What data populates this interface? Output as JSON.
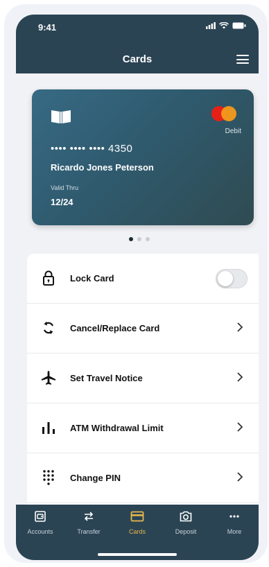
{
  "status": {
    "time": "9:41"
  },
  "header": {
    "title": "Cards"
  },
  "card": {
    "number": "•••• •••• •••• 4350",
    "holder": "Ricardo Jones Peterson",
    "valid_label": "Valid Thru",
    "valid_date": "12/24",
    "type": "Debit",
    "network": "mastercard-logo"
  },
  "carousel": {
    "pages": 3,
    "active_page": 1
  },
  "actions": [
    {
      "label": "Lock Card",
      "icon": "lock-icon",
      "control": "toggle",
      "value": false
    },
    {
      "label": "Cancel/Replace Card",
      "icon": "replace-icon",
      "control": "chevron"
    },
    {
      "label": "Set Travel Notice",
      "icon": "airplane-icon",
      "control": "chevron"
    },
    {
      "label": "ATM Withdrawal Limit",
      "icon": "bar-chart-icon",
      "control": "chevron"
    },
    {
      "label": "Change PIN",
      "icon": "keypad-icon",
      "control": "chevron"
    }
  ],
  "tabs": [
    {
      "label": "Accounts",
      "icon": "accounts-icon"
    },
    {
      "label": "Transfer",
      "icon": "transfer-icon"
    },
    {
      "label": "Cards",
      "icon": "card-icon",
      "active": true
    },
    {
      "label": "Deposit",
      "icon": "camera-icon"
    },
    {
      "label": "More",
      "icon": "more-icon"
    }
  ],
  "colors": {
    "primary": "#2b4454",
    "accent": "#e8b74c",
    "background": "#f1f2f5"
  }
}
